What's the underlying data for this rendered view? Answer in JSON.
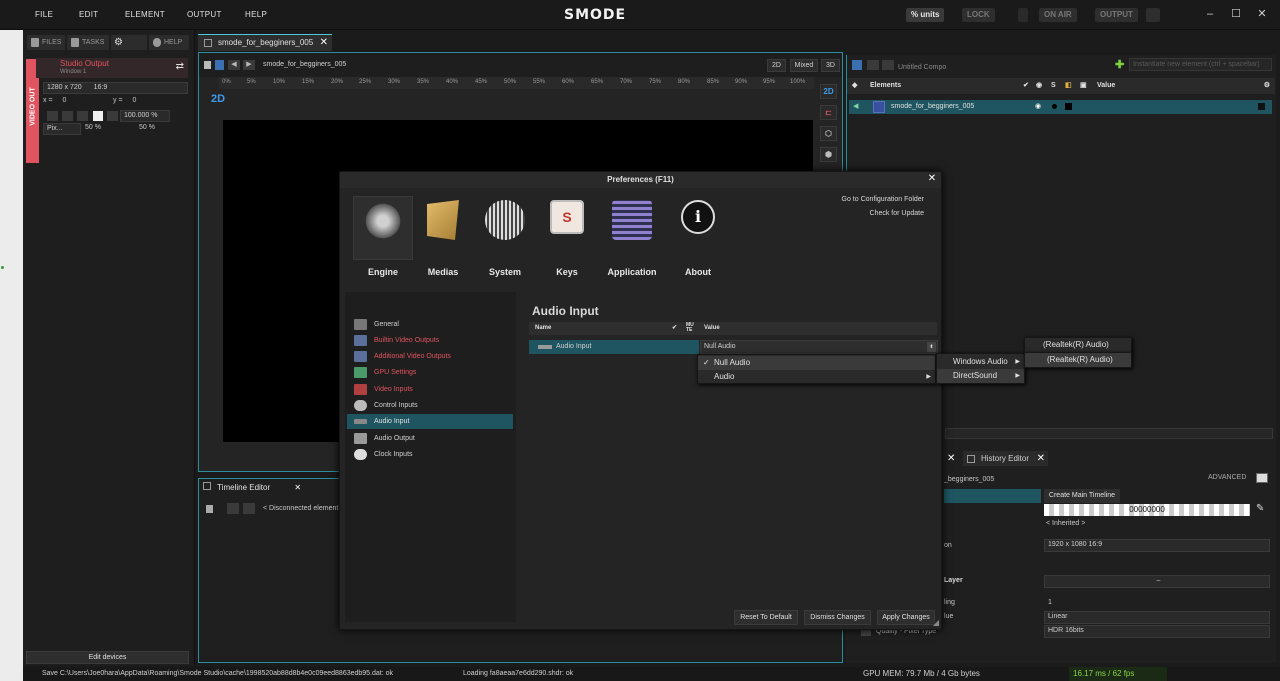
{
  "menubar": {
    "items": [
      "FILE",
      "EDIT",
      "ELEMENT",
      "OUTPUT",
      "HELP"
    ],
    "logo": "SMODE",
    "units_btn": "% units",
    "lock_btn": "LOCK",
    "on_air_btn": "ON AIR",
    "output_btn": "OUTPUT"
  },
  "left_panel": {
    "tabs": [
      "FILES",
      "TASKS",
      "HELP"
    ],
    "video_out_label": "VIDEO OUT",
    "studio_output": "Studio Output",
    "window_label": "Window 1",
    "resolution": "1280 x 720",
    "aspect": "16:9",
    "x_label": "x =",
    "x_value": "0",
    "y_label": "y =",
    "y_value": "0",
    "zoom": "100.000 %",
    "pix_label": "Pix...",
    "pct_a": "50 %",
    "pct_b": "50 %",
    "edit_devices": "Edit devices"
  },
  "viewport": {
    "tab_label": "smode_for_begginers_005",
    "doc_name": "smode_for_begginers_005",
    "mode_2d": "2D",
    "mode_mixed": "Mixed",
    "mode_3d": "3D",
    "badge_2d": "2D",
    "ruler_ticks": [
      "0%",
      "5%",
      "10%",
      "15%",
      "20%",
      "25%",
      "30%",
      "35%",
      "40%",
      "45%",
      "50%",
      "55%",
      "60%",
      "65%",
      "70%",
      "75%",
      "80%",
      "85%",
      "90%",
      "95%",
      "100%"
    ]
  },
  "timeline": {
    "tab_label": "Timeline Editor",
    "status": "< Disconnected element"
  },
  "right_panel": {
    "compo_name": "Untitled Compo",
    "search_placeholder": "Instantiate new element (ctrl + spacebar)",
    "col_elements": "Elements",
    "col_s": "S",
    "col_value": "Value",
    "row_name": "smode_for_begginers_005",
    "history_tab": "History Editor",
    "inspector_name": "_begginers_005",
    "advanced": "ADVANCED",
    "create_timeline": "Create Main Timeline",
    "timecode": "00000000",
    "inherited": "< Inherited >",
    "resolution_label": "on",
    "resolution_value": "1920 x 1080   16:9",
    "layer_label": "Layer",
    "ling_label": "ling",
    "ling_value": "1",
    "lue_label": "lue",
    "lue_value": "Linear",
    "quality_label": "Quality - Pixel Type",
    "quality_value": "HDR 16bits"
  },
  "statusbar": {
    "save_msg": "Save C:\\Users\\Joe0hara\\AppData\\Roaming\\Smode Studio\\cache\\1998520ab88d8b4e0c09eed8863edb95.dat: ok",
    "loading_msg": "Loading fa8aeaa7e6dd290.shdr: ok",
    "gpu_mem": "GPU MEM: 79.7 Mb / 4 Gb bytes",
    "fps": "16.17 ms / 62 fps"
  },
  "modal": {
    "title": "Preferences (F11)",
    "config_folder": "Go to Configuration Folder",
    "check_update": "Check for Update",
    "categories": [
      "Engine",
      "Medias",
      "System",
      "Keys",
      "Application",
      "About"
    ],
    "nav_items": [
      "General",
      "Builtin Video Outputs",
      "Additional Video Outputs",
      "GPU Settings",
      "Video Inputs",
      "Control Inputs",
      "Audio Input",
      "Audio Output",
      "Clock Inputs"
    ],
    "section_title": "Audio Input",
    "col_name": "Name",
    "col_mute": "MU TE",
    "col_value": "Value",
    "row_name": "Audio Input",
    "row_value": "Null Audio",
    "btn_reset": "Reset To Default",
    "btn_dismiss": "Dismiss Changes",
    "btn_apply": "Apply Changes"
  },
  "dropdown": {
    "level1": [
      "Null Audio",
      "Audio"
    ],
    "level2": [
      "Windows Audio",
      "DirectSound"
    ],
    "level3a": "(Realtek(R) Audio)",
    "level3b": "(Realtek(R) Audio)"
  },
  "colors": {
    "accent": "#2a8d9c",
    "selection": "#1e5560",
    "video_out": "#e0545f",
    "badge_blue": "#3f9be8",
    "fps_bg": "#8bd34a"
  }
}
